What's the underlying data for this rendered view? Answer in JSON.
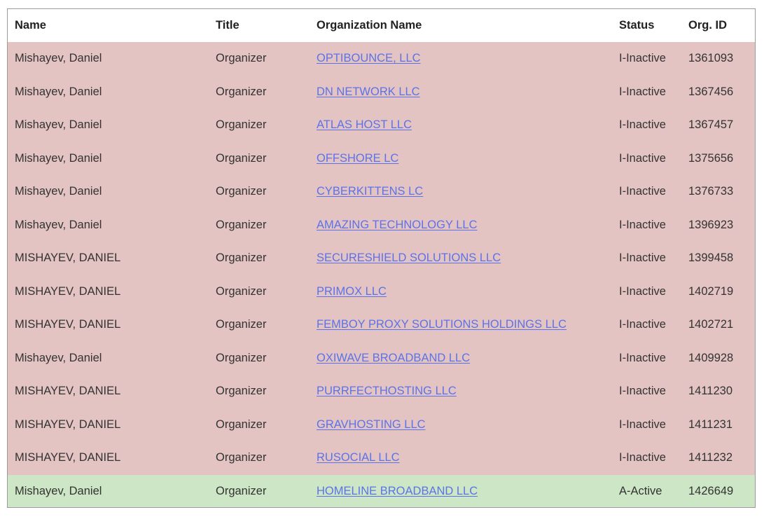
{
  "table": {
    "headers": {
      "name": "Name",
      "title": "Title",
      "organization": "Organization Name",
      "status": "Status",
      "org_id": "Org. ID"
    },
    "rows": [
      {
        "name": "Mishayev, Daniel",
        "title": "Organizer",
        "organization": "OPTIBOUNCE, LLC",
        "status": "I-Inactive",
        "org_id": "1361093"
      },
      {
        "name": "Mishayev, Daniel",
        "title": "Organizer",
        "organization": "DN NETWORK LLC",
        "status": "I-Inactive",
        "org_id": "1367456"
      },
      {
        "name": "Mishayev, Daniel",
        "title": "Organizer",
        "organization": "ATLAS HOST LLC",
        "status": "I-Inactive",
        "org_id": "1367457"
      },
      {
        "name": "Mishayev, Daniel",
        "title": "Organizer",
        "organization": "OFFSHORE LC",
        "status": "I-Inactive",
        "org_id": "1375656"
      },
      {
        "name": "Mishayev, Daniel",
        "title": "Organizer",
        "organization": "CYBERKITTENS LC",
        "status": "I-Inactive",
        "org_id": "1376733"
      },
      {
        "name": "Mishayev, Daniel",
        "title": "Organizer",
        "organization": "AMAZING TECHNOLOGY LLC",
        "status": "I-Inactive",
        "org_id": "1396923"
      },
      {
        "name": "MISHAYEV, DANIEL",
        "title": "Organizer",
        "organization": "SECURESHIELD SOLUTIONS LLC",
        "status": "I-Inactive",
        "org_id": "1399458"
      },
      {
        "name": "MISHAYEV, DANIEL",
        "title": "Organizer",
        "organization": "PRIMOX LLC",
        "status": "I-Inactive",
        "org_id": "1402719"
      },
      {
        "name": "MISHAYEV, DANIEL",
        "title": "Organizer",
        "organization": "FEMBOY PROXY SOLUTIONS HOLDINGS LLC",
        "status": "I-Inactive",
        "org_id": "1402721"
      },
      {
        "name": "Mishayev, Daniel",
        "title": "Organizer",
        "organization": "OXIWAVE BROADBAND LLC",
        "status": "I-Inactive",
        "org_id": "1409928"
      },
      {
        "name": "MISHAYEV, DANIEL",
        "title": "Organizer",
        "organization": "PURRFECTHOSTING LLC",
        "status": "I-Inactive",
        "org_id": "1411230"
      },
      {
        "name": "MISHAYEV, DANIEL",
        "title": "Organizer",
        "organization": "GRAVHOSTING LLC",
        "status": "I-Inactive",
        "org_id": "1411231"
      },
      {
        "name": "MISHAYEV, DANIEL",
        "title": "Organizer",
        "organization": "RUSOCIAL LLC",
        "status": "I-Inactive",
        "org_id": "1411232"
      },
      {
        "name": "Mishayev, Daniel",
        "title": "Organizer",
        "organization": "HOMELINE BROADBAND LLC",
        "status": "A-Active",
        "org_id": "1426649"
      }
    ]
  },
  "colors": {
    "inactive_row": "#e4c3c3",
    "active_row": "#cde6c5",
    "link": "#5b73e8"
  }
}
